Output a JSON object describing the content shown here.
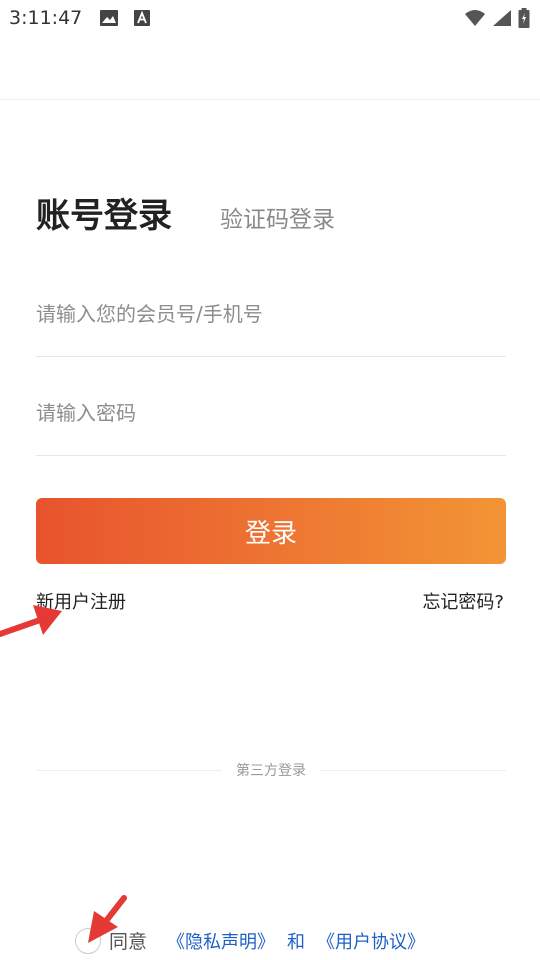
{
  "status_bar": {
    "time": "3:11:47",
    "left_icons": [
      "image-icon",
      "accessibility-icon"
    ],
    "right_icons": [
      "wifi-icon",
      "signal-icon",
      "battery-icon"
    ]
  },
  "tabs": {
    "account_login": "账号登录",
    "code_login": "验证码登录"
  },
  "form": {
    "username_placeholder": "请输入您的会员号/手机号",
    "password_placeholder": "请输入密码",
    "login_button": "登录"
  },
  "links": {
    "register": "新用户注册",
    "forgot_password": "忘记密码?"
  },
  "third_party": {
    "label": "第三方登录"
  },
  "agreement": {
    "agree": "同意",
    "privacy": "《隐私声明》",
    "and": "和",
    "user_agreement": "《用户协议》"
  },
  "colors": {
    "button_start": "#e8532e",
    "button_end": "#f29535",
    "link": "#1f5fc9",
    "annotation_arrow": "#e53935"
  }
}
